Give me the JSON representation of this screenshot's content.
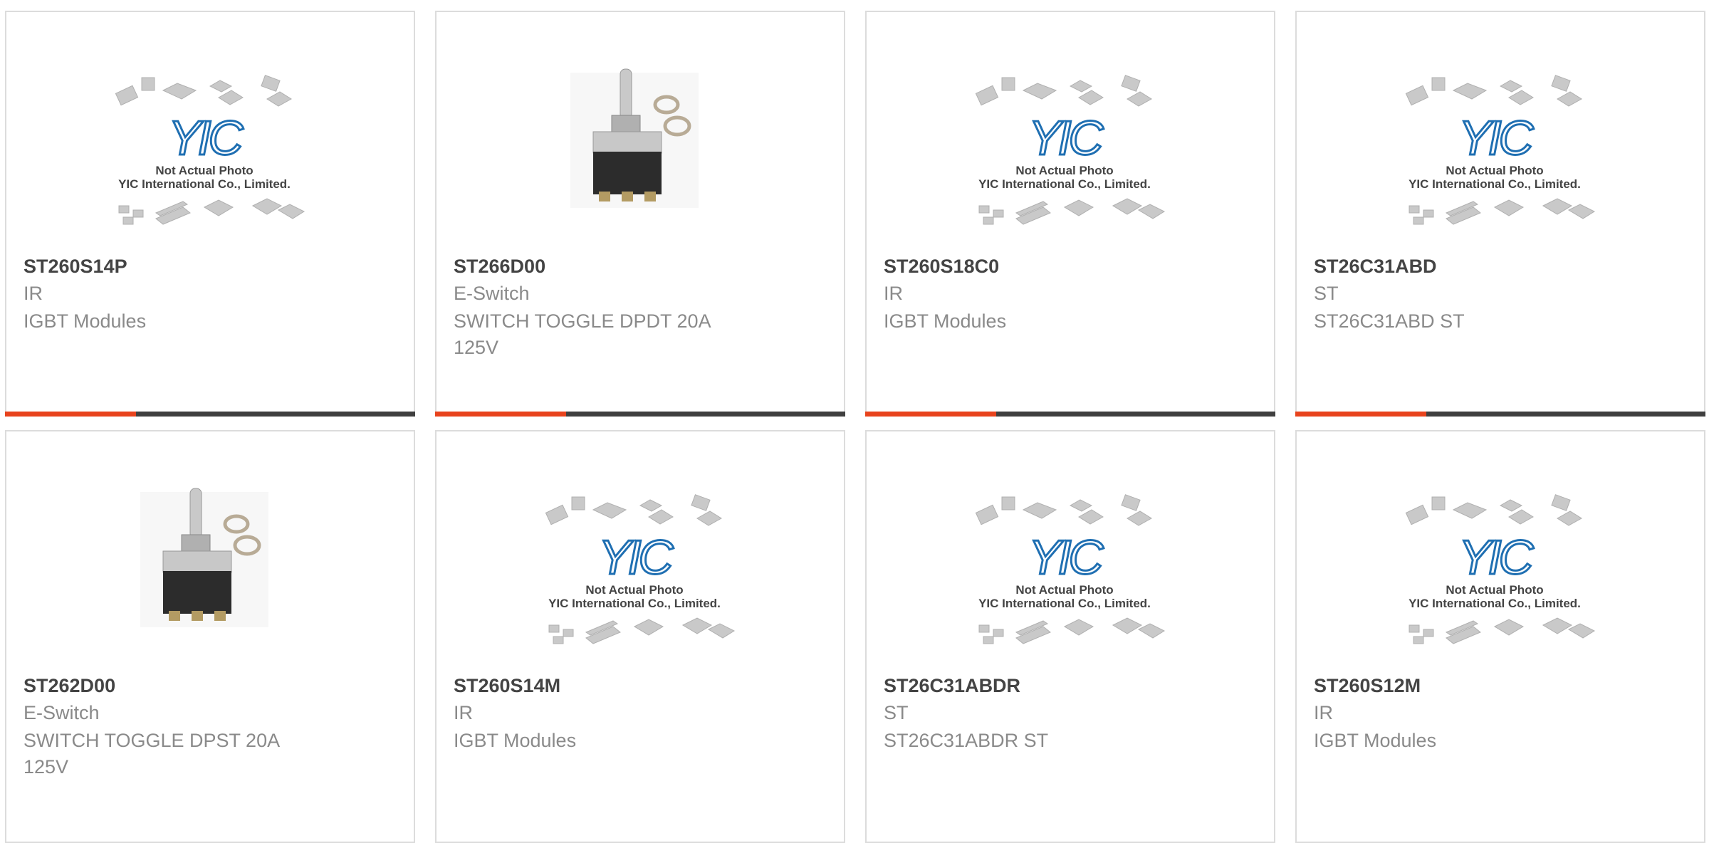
{
  "products": [
    {
      "part": "ST260S14P",
      "brand": "IR",
      "desc": "IGBT Modules",
      "image": "yic-placeholder"
    },
    {
      "part": "ST266D00",
      "brand": "E-Switch",
      "desc": "SWITCH TOGGLE DPDT 20A 125V",
      "image": "toggle-switch"
    },
    {
      "part": "ST260S18C0",
      "brand": "IR",
      "desc": "IGBT Modules",
      "image": "yic-placeholder"
    },
    {
      "part": "ST26C31ABD",
      "brand": "ST",
      "desc": "ST26C31ABD ST",
      "image": "yic-placeholder"
    },
    {
      "part": "ST262D00",
      "brand": "E-Switch",
      "desc": "SWITCH TOGGLE DPST 20A 125V",
      "image": "toggle-switch"
    },
    {
      "part": "ST260S14M",
      "brand": "IR",
      "desc": "IGBT Modules",
      "image": "yic-placeholder"
    },
    {
      "part": "ST26C31ABDR",
      "brand": "ST",
      "desc": "ST26C31ABDR ST",
      "image": "yic-placeholder"
    },
    {
      "part": "ST260S12M",
      "brand": "IR",
      "desc": "IGBT Modules",
      "image": "yic-placeholder"
    }
  ],
  "placeholder": {
    "logo_text": "YIC",
    "line1": "Not Actual Photo",
    "line2": "YIC International Co., Limited."
  },
  "colors": {
    "accent": "#e8431d",
    "bar": "#3f3f3f",
    "title": "#444444",
    "muted": "#8a8a8a",
    "logo": "#1f6fb2"
  }
}
